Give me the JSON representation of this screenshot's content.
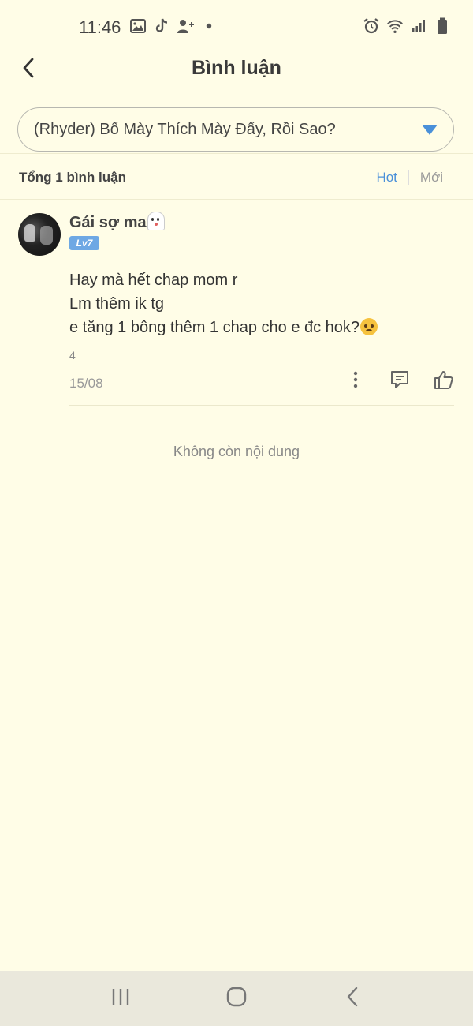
{
  "status_bar": {
    "time": "11:46",
    "left_icons": [
      "gallery-icon",
      "tiktok-icon",
      "add-user-icon",
      "dot-icon"
    ],
    "right_icons": [
      "alarm-icon",
      "wifi-icon",
      "signal-icon",
      "battery-icon"
    ]
  },
  "header": {
    "title": "Bình luận",
    "back_icon": "chevron-left-icon"
  },
  "chapter_select": {
    "value": "(Rhyder) Bố Mày Thích Mày Đấy, Rồi Sao?",
    "icon": "chevron-down-icon"
  },
  "summary": {
    "total": "Tổng 1 bình luận",
    "sort_tabs": [
      {
        "label": "Hot",
        "active": true
      },
      {
        "label": "Mới",
        "active": false
      }
    ]
  },
  "comments": [
    {
      "username": "Gái sợ ma",
      "username_emoji": "ghost-icon",
      "level": "Lv7",
      "lines": [
        "Hay mà hết chap mom r",
        "Lm thêm ik tg",
        "e tăng 1 bông thêm 1 chap cho e đc hok?"
      ],
      "line3_emoji": "pleading-face-icon",
      "likes": "4",
      "date": "15/08",
      "actions": [
        "more-icon",
        "reply-icon",
        "like-icon"
      ]
    }
  ],
  "empty_message": "Không còn nội dung",
  "colors": {
    "background": "#fffde7",
    "accent": "#4a90d9",
    "level_badge": "#6ea8e4",
    "nav_bar": "#eae8dc"
  },
  "nav_bar": [
    "recent-apps-icon",
    "home-icon",
    "back-icon"
  ]
}
